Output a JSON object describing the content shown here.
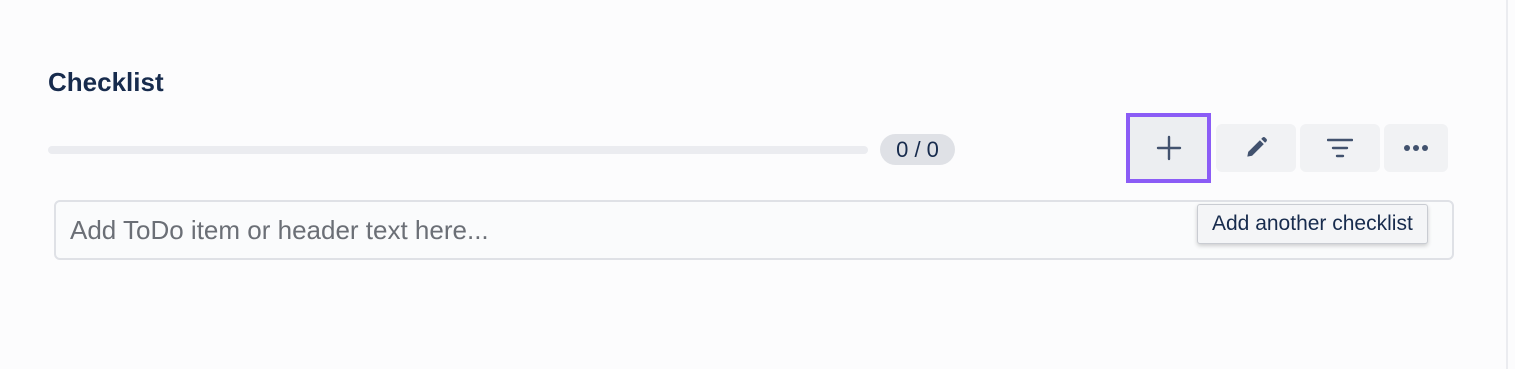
{
  "checklist": {
    "title": "Checklist",
    "progress": {
      "label": "0 / 0",
      "completed": 0,
      "total": 0,
      "fraction": 0
    }
  },
  "toolbar": {
    "add_icon": "plus-icon",
    "edit_icon": "pencil-icon",
    "filter_icon": "filter-icon",
    "more_icon": "ellipsis-icon"
  },
  "todo_input": {
    "placeholder": "Add ToDo item or header text here...",
    "value": ""
  },
  "tooltip": {
    "text": "Add another checklist"
  },
  "colors": {
    "highlight": "#8b5cf6",
    "text": "#172b4d",
    "badge_bg": "#dfe1e6"
  }
}
